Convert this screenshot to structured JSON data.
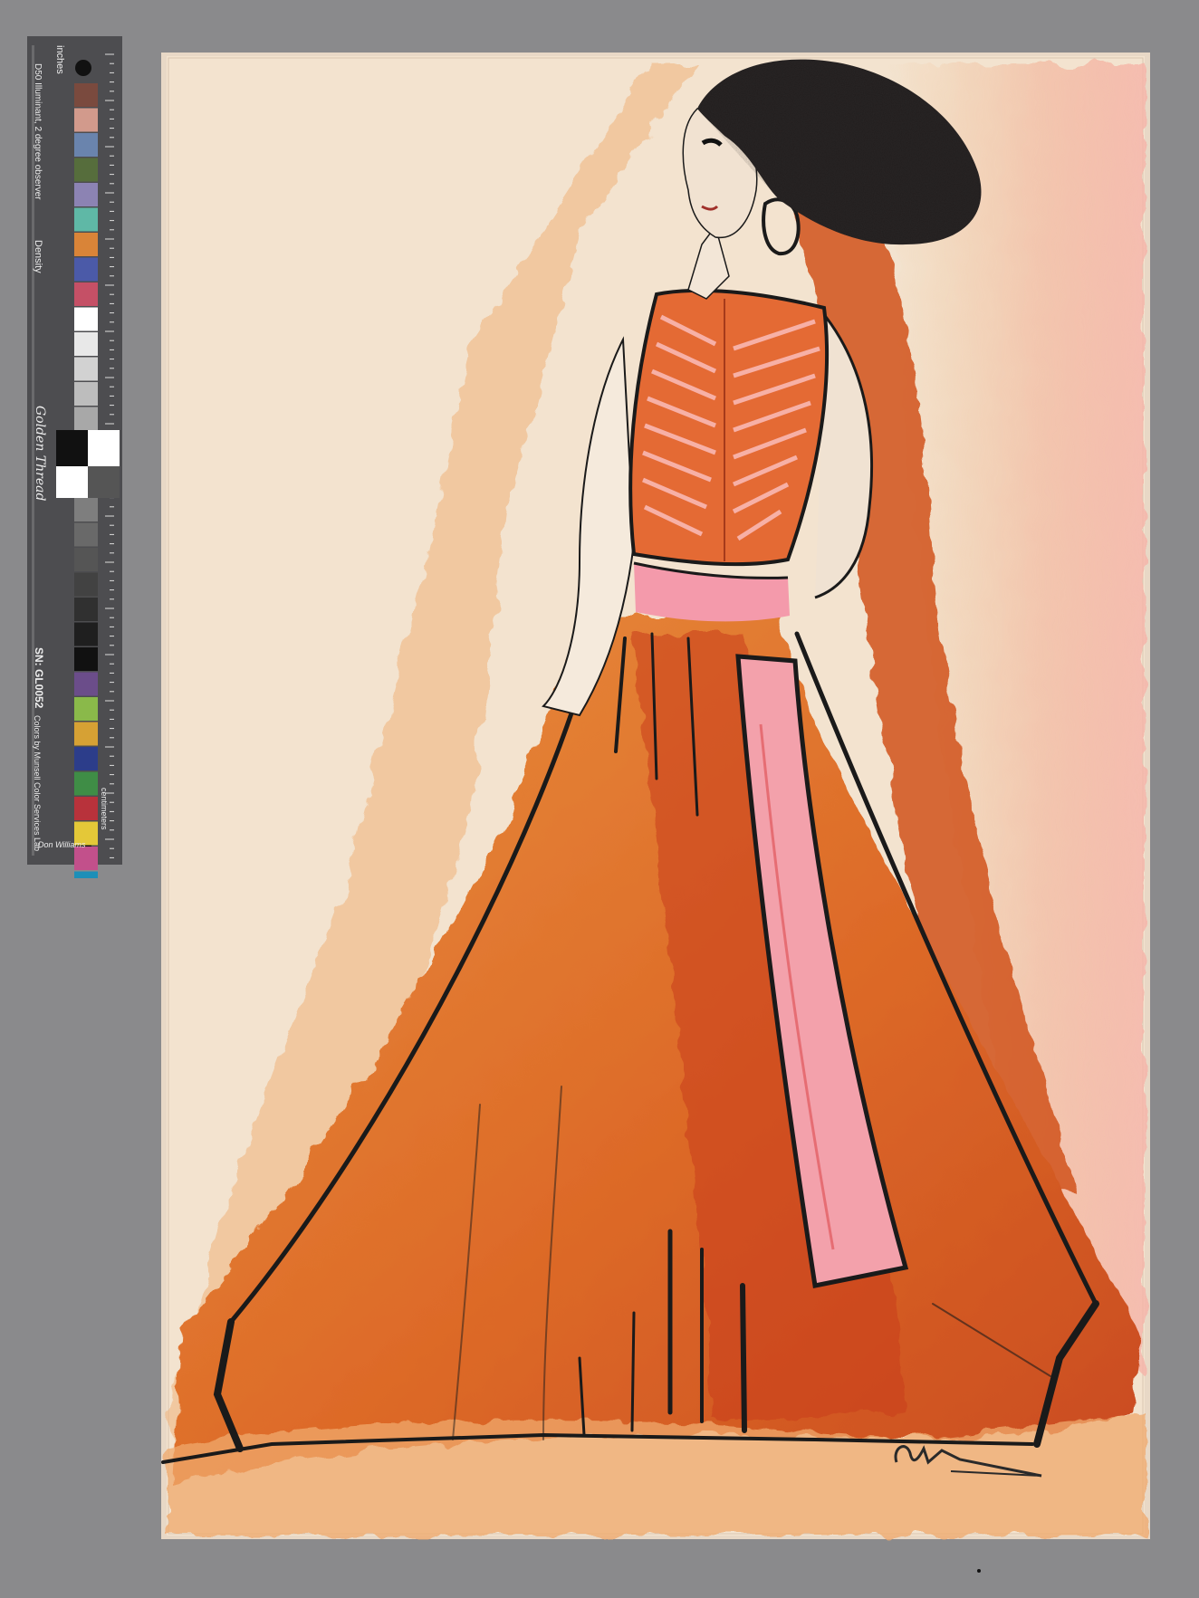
{
  "scene": {
    "background_color": "#8a8a8c",
    "paper_color": "#f3e3cf"
  },
  "color_card": {
    "header_inches": "inches",
    "header_cm": "centimeters",
    "illuminant": "D50 Illuminant, 2 degree observer",
    "density_label": "Density",
    "brand_script": "Golden Thread",
    "serial": "SN: GL0052",
    "colors_by": "Colors by Munsell Color Services Lab",
    "signature": "Don Williams",
    "patch_colors": [
      "#7a4a3e",
      "#d29a8c",
      "#6a84ad",
      "#566d3c",
      "#8c83b3",
      "#5fb8a6",
      "#d98438",
      "#4b5aa8",
      "#c55066",
      "#ffffff",
      "#e8e8e8",
      "#d2d2d2",
      "#bdbdbd",
      "#a8a8a8",
      "#939393",
      "#7e7e7e",
      "#696969",
      "#555555",
      "#424242",
      "#303030",
      "#1f1f1f",
      "#111111",
      "#6b4d8a",
      "#8ab94a",
      "#d6a134",
      "#2c3d8a",
      "#3f8d46",
      "#b8323b",
      "#e4c838",
      "#c2508b",
      "#1d8fb8"
    ]
  },
  "artwork": {
    "palette": {
      "dress_orange": "#e07a2c",
      "dress_red": "#c9441c",
      "sash_pink": "#f09aa6",
      "charcoal": "#1a1a1a",
      "hair": "#2a2626",
      "wash_pink": "#f6b3a8"
    }
  }
}
